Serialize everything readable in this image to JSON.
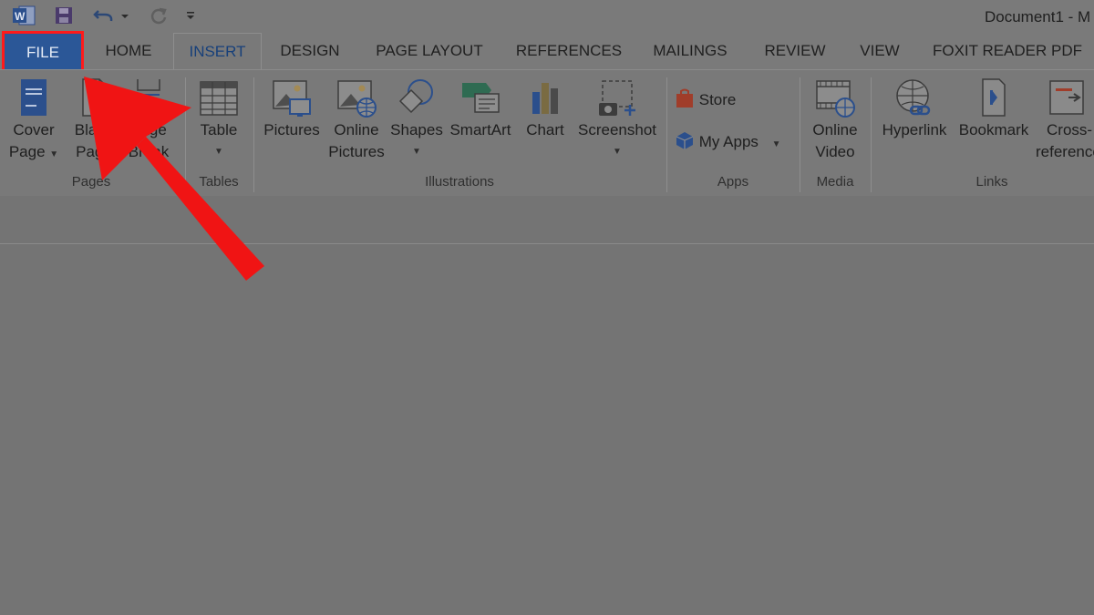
{
  "window": {
    "title": "Document1 - M"
  },
  "quick_access": {
    "icons": [
      "word-icon",
      "save-icon",
      "undo-icon",
      "redo-icon",
      "customize-icon"
    ]
  },
  "tabs": [
    {
      "label": "FILE"
    },
    {
      "label": "HOME"
    },
    {
      "label": "INSERT"
    },
    {
      "label": "DESIGN"
    },
    {
      "label": "PAGE LAYOUT"
    },
    {
      "label": "REFERENCES"
    },
    {
      "label": "MAILINGS"
    },
    {
      "label": "REVIEW"
    },
    {
      "label": "VIEW"
    },
    {
      "label": "FOXIT READER PDF"
    }
  ],
  "ribbon": {
    "groups": {
      "pages": "Pages",
      "tables": "Tables",
      "illustrations": "Illustrations",
      "apps": "Apps",
      "media": "Media",
      "links": "Links"
    },
    "buttons": {
      "cover_page": [
        "Cover",
        "Page"
      ],
      "blank_page": [
        "Blank",
        "Page"
      ],
      "page_break": [
        "Page",
        "Break"
      ],
      "table": "Table",
      "pictures": "Pictures",
      "online_pictures": [
        "Online",
        "Pictures"
      ],
      "shapes": "Shapes",
      "smartart": "SmartArt",
      "chart": "Chart",
      "screenshot": "Screenshot",
      "store": "Store",
      "my_apps": "My Apps",
      "online_video": [
        "Online",
        "Video"
      ],
      "hyperlink": "Hyperlink",
      "bookmark": "Bookmark",
      "cross_reference": [
        "Cross-",
        "reference"
      ]
    }
  },
  "annotation": {
    "highlight": "FILE",
    "color": "#ff1a1a"
  }
}
